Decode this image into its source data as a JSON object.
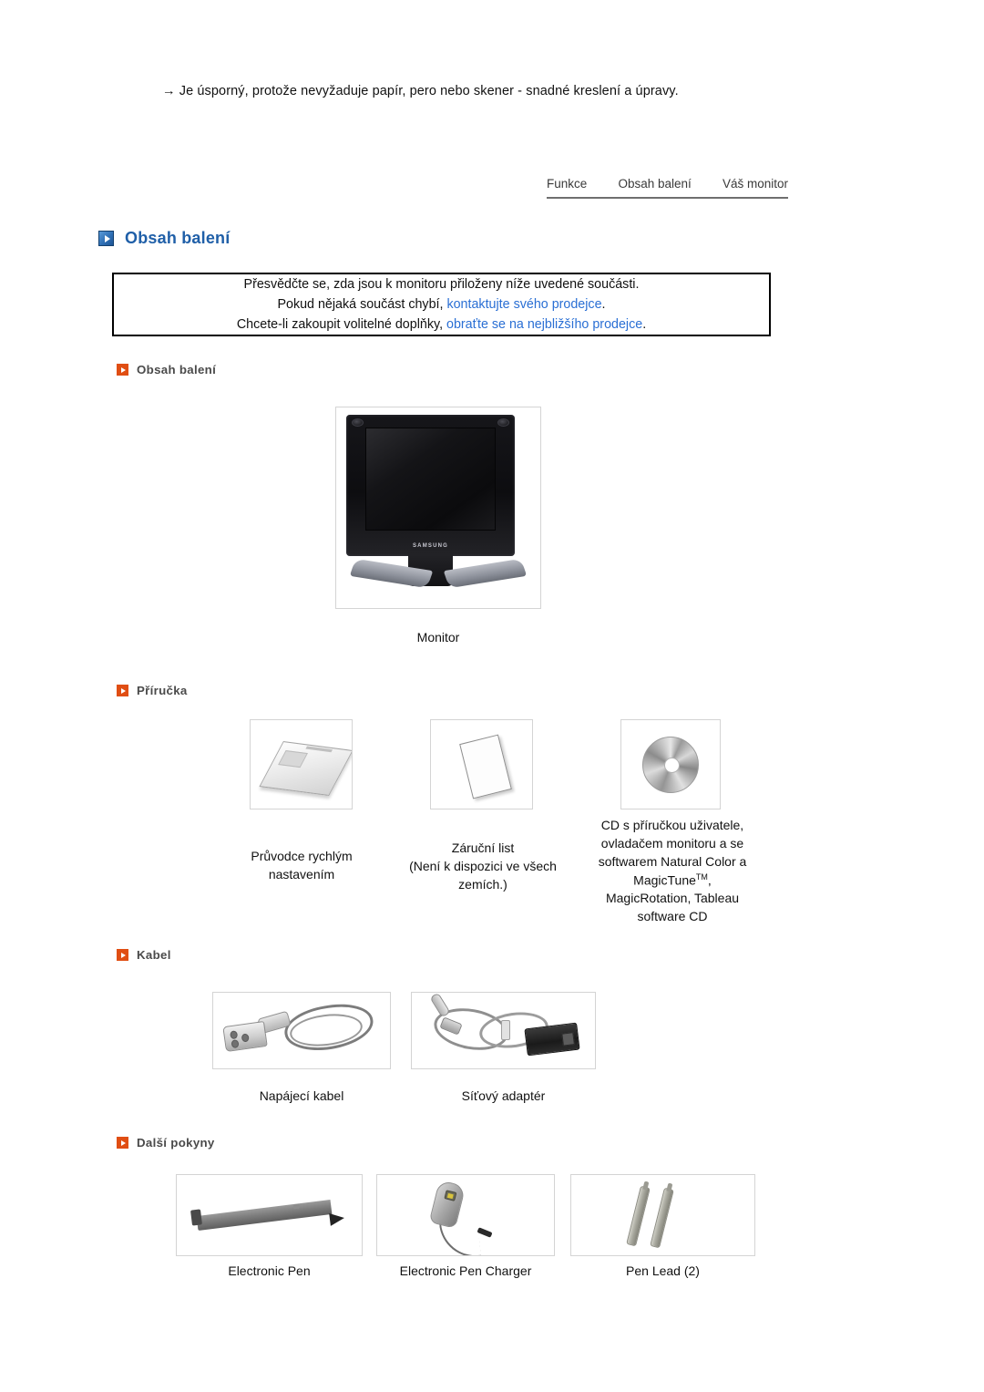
{
  "intro": {
    "text": "→ Je úsporný, protože nevyžaduje papír, pero nebo skener - snadné kreslení a úpravy."
  },
  "tabs": [
    {
      "label": "Funkce"
    },
    {
      "label": "Obsah balení"
    },
    {
      "label": "Váš monitor"
    }
  ],
  "page_heading": {
    "title": "Obsah balení",
    "icon": "blue-arrow-icon",
    "color": "#1f5fa8"
  },
  "notice": {
    "line1": "Přesvědčte se, zda jsou k monitoru přiloženy níže uvedené součásti.",
    "line2_prefix": "Pokud nějaká součást chybí, ",
    "line2_link": "kontaktujte svého prodejce",
    "line2_suffix": ".",
    "line3_prefix": "Chcete-li zakoupit volitelné doplňky, ",
    "line3_link": "obraťte se na nejbližšího prodejce",
    "line3_suffix": ".",
    "link_color": "#2a6fd4"
  },
  "sections": [
    {
      "label": "Obsah balení",
      "icon": "orange-arrow-icon"
    },
    {
      "label": "Příručka",
      "icon": "orange-arrow-icon"
    },
    {
      "label": "Kabel",
      "icon": "orange-arrow-icon"
    },
    {
      "label": "Další pokyny",
      "icon": "orange-arrow-icon"
    }
  ],
  "section_icon_color": "#e04e13",
  "items": {
    "monitor": {
      "caption": "Monitor",
      "image": "lcd-monitor-image",
      "brand": "SAMSUNG"
    },
    "quickguide": {
      "caption_line1": "Průvodce rychlým",
      "caption_line2": "nastavením",
      "image": "quick-setup-guide-image"
    },
    "warranty": {
      "caption_line1": "Záruční list",
      "caption_line2": "(Není k dispozici ve všech",
      "caption_line3": "zemích.)",
      "image": "warranty-card-image"
    },
    "cd": {
      "caption_line1": "CD s příručkou uživatele,",
      "caption_line2": "ovladačem monitoru a se",
      "caption_line3": "softwarem Natural Color a",
      "caption_line4_main": "MagicTune",
      "caption_line4_sup": "TM",
      "caption_line4_tail": ",",
      "caption_line5": "MagicRotation, Tableau",
      "caption_line6": "software CD",
      "image": "software-cd-image"
    },
    "powercable": {
      "caption": "Napájecí kabel",
      "image": "power-cable-image"
    },
    "adapter": {
      "caption": "Síťový adaptér",
      "image": "power-adapter-image"
    },
    "epen": {
      "caption": "Electronic Pen",
      "image": "electronic-pen-image"
    },
    "epencharger": {
      "caption": "Electronic Pen Charger",
      "image": "electronic-pen-charger-image"
    },
    "penlead": {
      "caption": "Pen Lead (2)",
      "image": "pen-lead-image"
    }
  }
}
